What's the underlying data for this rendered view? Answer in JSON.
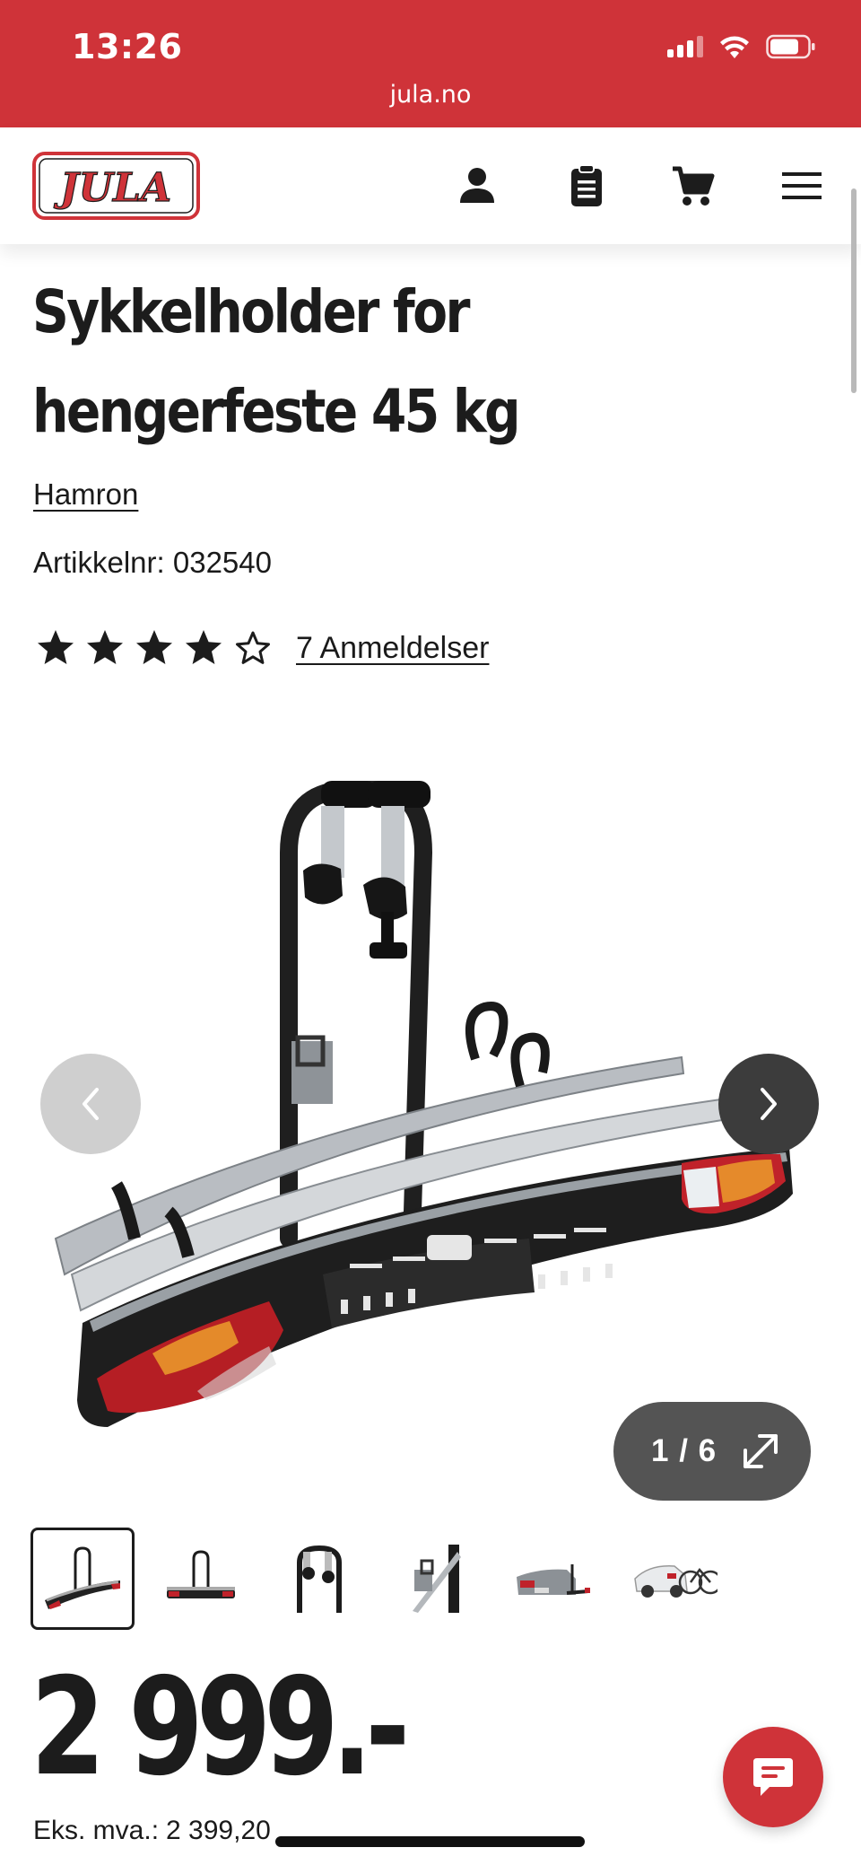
{
  "status_bar": {
    "time": "13:26",
    "url": "jula.no"
  },
  "header": {
    "logo_text": "JULA",
    "icons": [
      "account-icon",
      "shopping-list-icon",
      "cart-icon",
      "menu-icon"
    ]
  },
  "product": {
    "title_line1": "Sykkelholder for",
    "title_line2": "hengerfeste 45 kg",
    "brand": "Hamron",
    "article_number": "Artikkelnr: 032540",
    "rating": {
      "value": 4,
      "max": 5,
      "reviews_label": "7 Anmeldelser"
    }
  },
  "gallery": {
    "counter": "1 / 6",
    "current": 1,
    "total": 6,
    "thumbnails": [
      "thumbnail-1",
      "thumbnail-2",
      "thumbnail-3",
      "thumbnail-4",
      "thumbnail-5",
      "thumbnail-6"
    ]
  },
  "price": {
    "amount": "2 999.-",
    "ex_vat_label": "Eks. mva.:",
    "ex_vat_value": "2 399,20"
  },
  "colors": {
    "brand_red": "#cf3339",
    "text": "#1c1c1c"
  }
}
